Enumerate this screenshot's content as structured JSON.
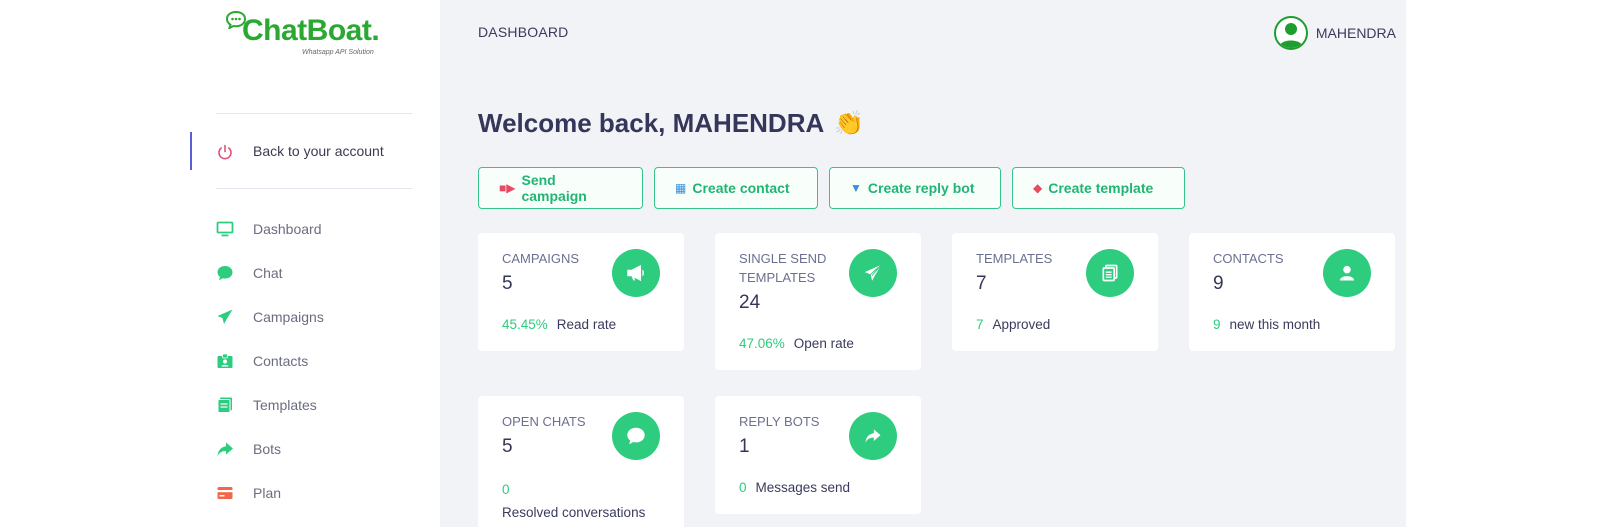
{
  "brand": {
    "name": "ChatBoat.",
    "tagline": "Whatsapp API Solution"
  },
  "sidebar": {
    "back": {
      "label": "Back to your account",
      "icon": "power-icon"
    },
    "items": [
      {
        "label": "Dashboard",
        "icon": "monitor-icon"
      },
      {
        "label": "Chat",
        "icon": "chat-bubble-icon"
      },
      {
        "label": "Campaigns",
        "icon": "send-icon"
      },
      {
        "label": "Contacts",
        "icon": "contact-card-icon"
      },
      {
        "label": "Templates",
        "icon": "templates-icon"
      },
      {
        "label": "Bots",
        "icon": "share-arrow-icon"
      },
      {
        "label": "Plan",
        "icon": "credit-card-icon"
      }
    ]
  },
  "header": {
    "title": "DASHBOARD",
    "user": "MAHENDRA"
  },
  "welcome": {
    "text": "Welcome back, MAHENDRA",
    "emoji": "👏"
  },
  "actions": [
    {
      "label": "Send campaign",
      "icon": "megaphone-icon"
    },
    {
      "label": "Create contact",
      "icon": "id-card-icon"
    },
    {
      "label": "Create reply bot",
      "icon": "inbox-icon"
    },
    {
      "label": "Create template",
      "icon": "pushpin-icon"
    }
  ],
  "cards": {
    "campaigns": {
      "title": "CAMPAIGNS",
      "value": "5",
      "stat": "45.45%",
      "stat_label": "Read rate",
      "icon": "megaphone-icon"
    },
    "single_send": {
      "title": "SINGLE SEND TEMPLATES",
      "value": "24",
      "stat": "47.06%",
      "stat_label": "Open rate",
      "icon": "paper-plane-icon"
    },
    "templates": {
      "title": "TEMPLATES",
      "value": "7",
      "stat": "7",
      "stat_label": "Approved",
      "icon": "documents-icon"
    },
    "contacts": {
      "title": "CONTACTS",
      "value": "9",
      "stat": "9",
      "stat_label": "new this month",
      "icon": "user-icon"
    },
    "open_chats": {
      "title": "OPEN CHATS",
      "value": "5",
      "stat": "0",
      "stat_label": "Resolved conversations",
      "icon": "chat-bubble-icon"
    },
    "reply_bots": {
      "title": "REPLY BOTS",
      "value": "1",
      "stat": "0",
      "stat_label": "Messages send",
      "icon": "share-arrow-icon"
    }
  },
  "colors": {
    "accent": "#2ecc7f",
    "brand": "#2aa832",
    "active": "#5b5fd6",
    "background": "#f2f3f6"
  }
}
